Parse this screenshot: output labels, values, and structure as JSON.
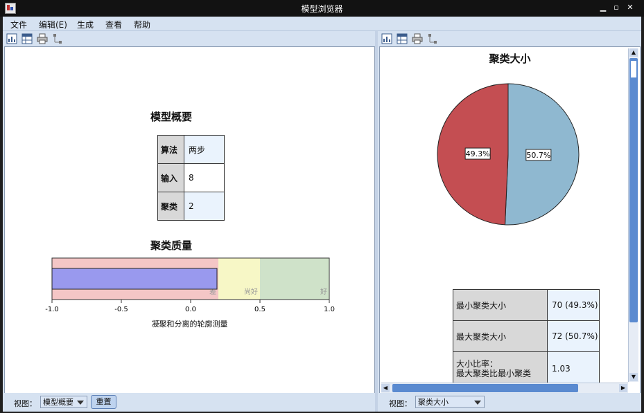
{
  "window": {
    "title": "模型浏览器"
  },
  "menu": [
    "文件",
    "编辑(E)",
    "生成",
    "查看",
    "帮助"
  ],
  "left": {
    "model_summary": {
      "title": "模型概要",
      "rows": [
        {
          "key": "算法",
          "value": "两步"
        },
        {
          "key": "输入",
          "value": "8"
        },
        {
          "key": "聚类",
          "value": "2"
        }
      ]
    },
    "cluster_quality": {
      "title": "聚类质量",
      "zones": [
        "差",
        "尚好",
        "好"
      ],
      "ticks": [
        "-1.0",
        "-0.5",
        "0.0",
        "0.5",
        "1.0"
      ],
      "xlabel": "凝聚和分离的轮廓测量"
    },
    "view_label": "视图：",
    "view_value": "模型概要",
    "reset_label": "重置"
  },
  "right": {
    "title": "聚类大小",
    "sizes_table": [
      {
        "key": "最小聚类大小",
        "value": "70 (49.3%)"
      },
      {
        "key": "最大聚类大小",
        "value": "72 (50.7%)"
      },
      {
        "key": "大小比率：\n最大聚类比最小聚类",
        "value": "1.03"
      }
    ],
    "view_label": "视图：",
    "view_value": "聚类大小"
  },
  "colors": {
    "slice_small": "#c44e52",
    "slice_large": "#8fb8d0",
    "quality_bar": "#9999ee",
    "zone_poor": "#f4c6c6",
    "zone_fair": "#f7f7c6",
    "zone_good": "#cfe2c9"
  },
  "chart_data": [
    {
      "type": "pie",
      "title": "聚类大小",
      "slices": [
        {
          "label": "49.3%",
          "value": 49.3
        },
        {
          "label": "50.7%",
          "value": 50.7
        }
      ]
    },
    {
      "type": "bar",
      "title": "聚类质量",
      "xlabel": "凝聚和分离的轮廓测量",
      "xlim": [
        -1.0,
        1.0
      ],
      "value": 0.19,
      "zones": [
        {
          "label": "差",
          "from": -1.0,
          "to": 0.2
        },
        {
          "label": "尚好",
          "from": 0.2,
          "to": 0.5
        },
        {
          "label": "好",
          "from": 0.5,
          "to": 1.0
        }
      ]
    }
  ]
}
